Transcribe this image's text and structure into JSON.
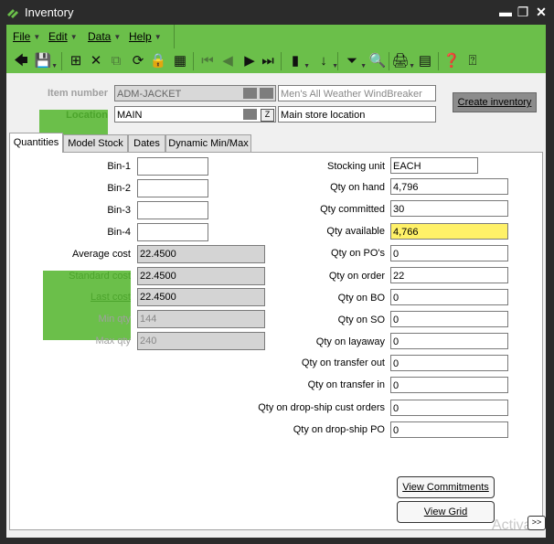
{
  "window": {
    "title": "Inventory",
    "accent": "#6bbf4a"
  },
  "menu": {
    "file": "File",
    "edit": "Edit",
    "data": "Data",
    "help": "Help"
  },
  "toolbar": {
    "icons": [
      "back-arrow-icon",
      "save-icon",
      "add-icon",
      "delete-icon",
      "copy-icon",
      "refresh-icon",
      "lock-icon",
      "grid-icon",
      "first-record-icon",
      "previous-record-icon",
      "next-record-icon",
      "last-record-icon",
      "bookmark-icon",
      "sort-icon",
      "filter-icon",
      "search-icon",
      "print-icon",
      "calculator-icon",
      "help-icon",
      "whats-this-icon"
    ]
  },
  "header": {
    "item_number_label": "Item number",
    "item_number_value": "ADM-JACKET",
    "item_description": "Men's All Weather WindBreaker",
    "location_label": "Location",
    "location_value": "MAIN",
    "location_description": "Main store location",
    "create_inventory_label": "Create inventory"
  },
  "tabs": [
    "Quantities",
    "Model Stock",
    "Dates",
    "Dynamic Min/Max"
  ],
  "left": {
    "bin1_label": "Bin-1",
    "bin2_label": "Bin-2",
    "bin3_label": "Bin-3",
    "bin4_label": "Bin-4",
    "bin1_value": "",
    "bin2_value": "",
    "bin3_value": "",
    "bin4_value": "",
    "average_cost_label": "Average cost",
    "average_cost_value": "22.4500",
    "standard_cost_label": "Standard cost",
    "standard_cost_value": "22.4500",
    "last_cost_label": "Last cost",
    "last_cost_value": "22.4500",
    "min_qty_label": "Min qty",
    "min_qty_value": "144",
    "max_qty_label": "Max qty",
    "max_qty_value": "240"
  },
  "right": {
    "stocking_unit_label": "Stocking unit",
    "stocking_unit_value": "EACH",
    "qty_on_hand_label": "Qty on hand",
    "qty_on_hand_value": "4,796",
    "qty_committed_label": "Qty committed",
    "qty_committed_value": "30",
    "qty_available_label": "Qty available",
    "qty_available_value": "4,766",
    "qty_on_pos_label": "Qty on PO's",
    "qty_on_pos_value": "0",
    "qty_on_order_label": "Qty on order",
    "qty_on_order_value": "22",
    "qty_on_bo_label": "Qty on BO",
    "qty_on_bo_value": "0",
    "qty_on_so_label": "Qty on SO",
    "qty_on_so_value": "0",
    "qty_on_layaway_label": "Qty on layaway",
    "qty_on_layaway_value": "0",
    "qty_transfer_out_label": "Qty on transfer out",
    "qty_transfer_out_value": "0",
    "qty_transfer_in_label": "Qty on transfer in",
    "qty_transfer_in_value": "0",
    "qty_dropship_cust_label": "Qty on drop-ship cust orders",
    "qty_dropship_cust_value": "0",
    "qty_dropship_po_label": "Qty on drop-ship PO",
    "qty_dropship_po_value": "0"
  },
  "buttons": {
    "view_commitments": "View Commitments",
    "view_grid": "View Grid",
    "more": ">>"
  },
  "watermark": "Activa"
}
